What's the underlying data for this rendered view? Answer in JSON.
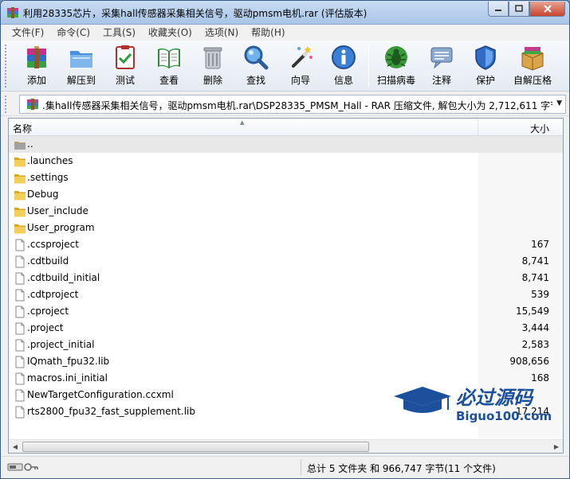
{
  "window": {
    "title": "利用28335芯片，采集hall传感器采集相关信号，驱动pmsm电机.rar (评估版本)"
  },
  "menu": [
    "文件(F)",
    "命令(C)",
    "工具(S)",
    "收藏夹(O)",
    "选项(N)",
    "帮助(H)"
  ],
  "toolbar": {
    "add": "添加",
    "extract": "解压到",
    "test": "测试",
    "view": "查看",
    "delete": "删除",
    "find": "查找",
    "wizard": "向导",
    "info": "信息",
    "virus_scan": "扫描病毒",
    "comment": "注释",
    "protect": "保护",
    "sfx": "自解压格"
  },
  "address": {
    "path": ".集hall传感器采集相关信号，驱动pmsm电机.rar\\DSP28335_PMSM_Hall - RAR 压缩文件, 解包大小为 2,712,611 字节"
  },
  "columns": {
    "name": "名称",
    "size": "大小"
  },
  "files": [
    {
      "name": "..",
      "size": "",
      "type": "up"
    },
    {
      "name": ".launches",
      "size": "",
      "type": "folder"
    },
    {
      "name": ".settings",
      "size": "",
      "type": "folder"
    },
    {
      "name": "Debug",
      "size": "",
      "type": "folder"
    },
    {
      "name": "User_include",
      "size": "",
      "type": "folder"
    },
    {
      "name": "User_program",
      "size": "",
      "type": "folder"
    },
    {
      "name": ".ccsproject",
      "size": "167",
      "type": "file"
    },
    {
      "name": ".cdtbuild",
      "size": "8,741",
      "type": "file"
    },
    {
      "name": ".cdtbuild_initial",
      "size": "8,741",
      "type": "file"
    },
    {
      "name": ".cdtproject",
      "size": "539",
      "type": "file"
    },
    {
      "name": ".cproject",
      "size": "15,549",
      "type": "file"
    },
    {
      "name": ".project",
      "size": "3,444",
      "type": "file"
    },
    {
      "name": ".project_initial",
      "size": "2,583",
      "type": "file"
    },
    {
      "name": "IQmath_fpu32.lib",
      "size": "908,656",
      "type": "file"
    },
    {
      "name": "macros.ini_initial",
      "size": "168",
      "type": "file"
    },
    {
      "name": "NewTargetConfiguration.ccxml",
      "size": "",
      "type": "file"
    },
    {
      "name": "rts2800_fpu32_fast_supplement.lib",
      "size": "17,214",
      "type": "file"
    }
  ],
  "watermark": {
    "line1": "必过源码",
    "line2": "Biguo100.com"
  },
  "status": {
    "summary": "总计 5 文件夹 和 966,747 字节(11 个文件)"
  },
  "colors": {
    "titlebar": "#b9d1ee",
    "selection": "#e8e8e8",
    "watermark": "#1c4f9c"
  }
}
